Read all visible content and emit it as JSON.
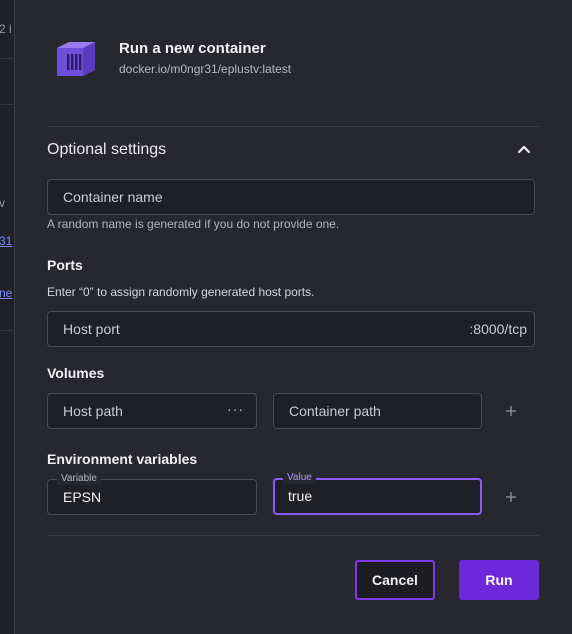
{
  "background": {
    "fragments": [
      "2 i",
      "v",
      "31",
      "ne"
    ]
  },
  "header": {
    "title": "Run a new container",
    "image": "docker.io/m0ngr31/eplustv:latest",
    "icon": "container-icon"
  },
  "optional_settings": {
    "label": "Optional settings",
    "expanded": true,
    "toggle_icon": "chevron-up-icon"
  },
  "container_name": {
    "placeholder": "Container name",
    "hint": "A random name is generated if you do not provide one."
  },
  "ports": {
    "title": "Ports",
    "hint": "Enter “0” to assign randomly generated host ports.",
    "host_port_placeholder": "Host port",
    "container_port": ":8000/tcp"
  },
  "volumes": {
    "title": "Volumes",
    "host_path_placeholder": "Host path",
    "browse_label": "···",
    "container_path_placeholder": "Container path",
    "add_icon": "plus-icon"
  },
  "env": {
    "title": "Environment variables",
    "variable_label": "Variable",
    "variable_value": "EPSN",
    "value_label": "Value",
    "value_value": "true",
    "add_icon": "plus-icon"
  },
  "actions": {
    "cancel_label": "Cancel",
    "run_label": "Run"
  },
  "colors": {
    "accent": "#7c3aed",
    "run_button": "#6d28d9",
    "modal_bg": "#27282f"
  }
}
